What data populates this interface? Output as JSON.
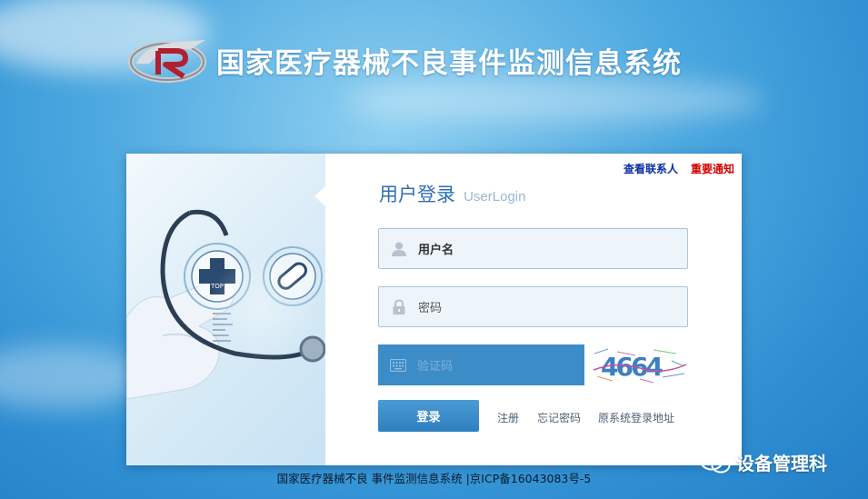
{
  "site": {
    "title": "国家医疗器械不良事件监测信息系统",
    "logo_letters": "CR"
  },
  "top_links": {
    "contacts": "查看联系人",
    "notice": "重要通知"
  },
  "login": {
    "title_cn": "用户登录",
    "title_en": "UserLogin",
    "username_placeholder": "用户名",
    "password_placeholder": "密码",
    "captcha_placeholder": "验证码",
    "captcha_code": "4664",
    "submit_label": "登录"
  },
  "actions": {
    "register": "注册",
    "forgot": "忘记密码",
    "old_address": "原系统登录地址"
  },
  "footer": {
    "text": "国家医疗器械不良 事件监测信息系统 |京ICP备16043083号-5"
  },
  "watermark": {
    "text": "设备管理科"
  },
  "hero": {
    "label": "TOP"
  },
  "colors": {
    "brand_blue": "#2d6fb7",
    "button_blue": "#3a87c6",
    "notice_red": "#d40000",
    "contact_blue": "#0b2fa3"
  }
}
